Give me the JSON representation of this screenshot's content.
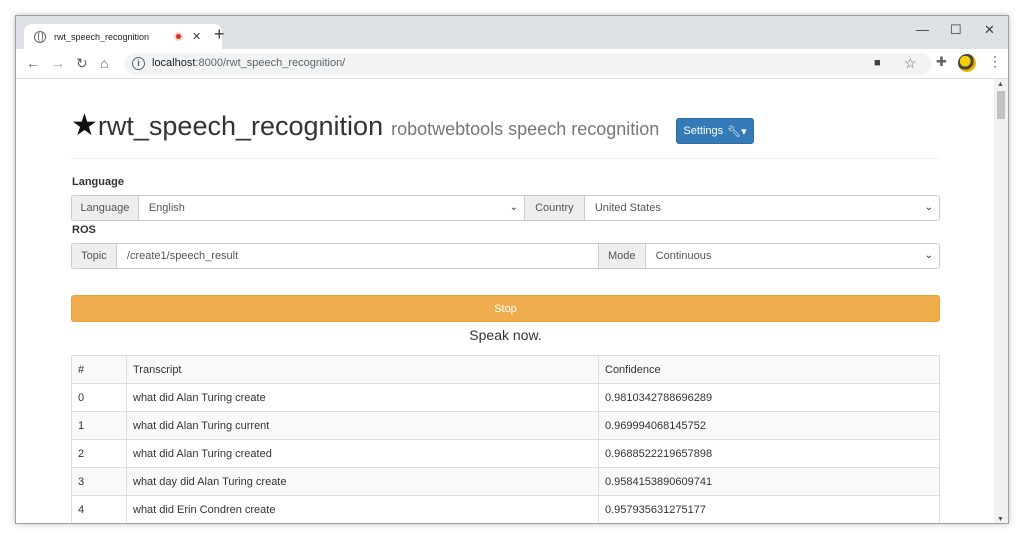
{
  "browser": {
    "tab_title": "rwt_speech_recognition",
    "url_host": "localhost",
    "url_path": ":8000/rwt_speech_recognition/"
  },
  "header": {
    "title": "rwt_speech_recognition",
    "subtitle": "robotwebtools speech recognition",
    "settings_label": "Settings"
  },
  "language_section": {
    "heading": "Language",
    "language_addon": "Language",
    "language_value": "English",
    "country_addon": "Country",
    "country_value": "United States"
  },
  "ros_section": {
    "heading": "ROS",
    "topic_addon": "Topic",
    "topic_value": "/create1/speech_result",
    "mode_addon": "Mode",
    "mode_value": "Continuous"
  },
  "stop_label": "Stop",
  "status_text": "Speak now.",
  "table": {
    "headers": [
      "#",
      "Transcript",
      "Confidence"
    ],
    "rows": [
      {
        "index": "0",
        "transcript": "what did Alan Turing create",
        "confidence": "0.9810342788696289"
      },
      {
        "index": "1",
        "transcript": "what did Alan Turing current",
        "confidence": "0.969994068145752"
      },
      {
        "index": "2",
        "transcript": "what did Alan Turing created",
        "confidence": "0.9688522219657898"
      },
      {
        "index": "3",
        "transcript": "what day did Alan Turing create",
        "confidence": "0.9584153890609741"
      },
      {
        "index": "4",
        "transcript": "what did Erin Condren create",
        "confidence": "0.957935631275177"
      }
    ]
  },
  "colors": {
    "settings_button": "#337ab7",
    "stop_button": "#f0ad4e",
    "recording_dot": "#d93025"
  }
}
